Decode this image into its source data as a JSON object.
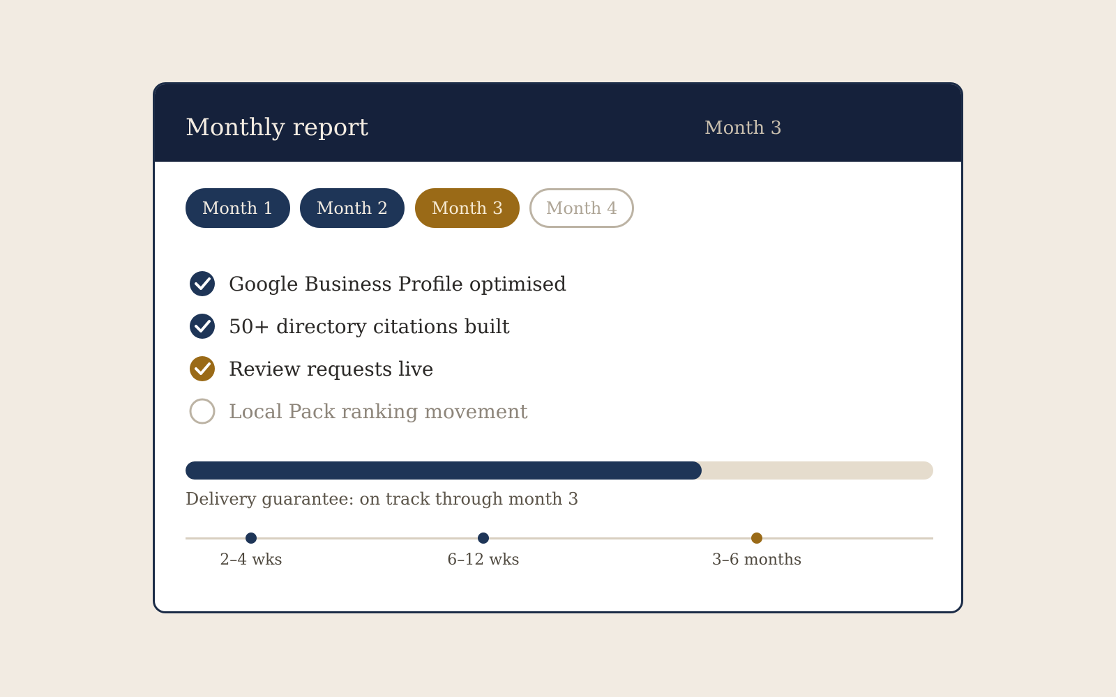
{
  "header": {
    "title": "Monthly report",
    "current_month": "Month 3"
  },
  "tabs": [
    {
      "label": "Month 1",
      "state": "done"
    },
    {
      "label": "Month 2",
      "state": "done"
    },
    {
      "label": "Month 3",
      "state": "current"
    },
    {
      "label": "Month 4",
      "state": "upcoming"
    }
  ],
  "checklist": [
    {
      "label": "Google Business Profile optimised",
      "status": "done",
      "icon": "check-circle-icon"
    },
    {
      "label": "50+ directory citations built",
      "status": "done",
      "icon": "check-circle-icon"
    },
    {
      "label": "Review requests live",
      "status": "current",
      "icon": "check-circle-icon"
    },
    {
      "label": "Local Pack ranking movement",
      "status": "pending",
      "icon": "empty-circle-icon"
    }
  ],
  "progress": {
    "percent": 69,
    "caption": "Delivery guarantee: on track through month 3"
  },
  "timeline": [
    {
      "label": "2–4 wks",
      "status": "done"
    },
    {
      "label": "6–12 wks",
      "status": "done"
    },
    {
      "label": "3–6 months",
      "status": "current"
    }
  ],
  "colors": {
    "navy": "#1e3557",
    "header_bg": "#15213b",
    "gold": "#9a6a17",
    "muted": "#bcb3a4",
    "page_bg": "#f2ebe2"
  }
}
